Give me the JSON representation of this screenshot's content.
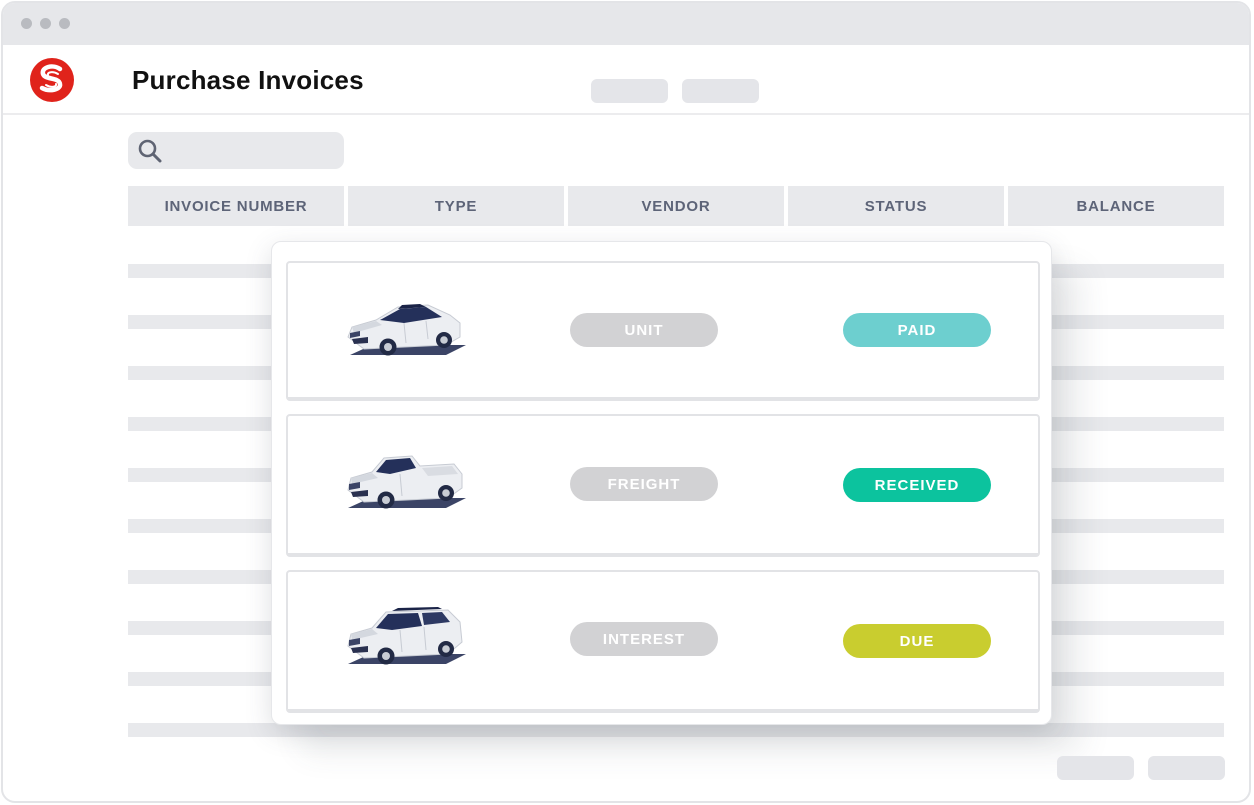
{
  "header": {
    "title": "Purchase Invoices"
  },
  "table": {
    "columns": [
      "INVOICE NUMBER",
      "TYPE",
      "VENDOR",
      "STATUS",
      "BALANCE"
    ]
  },
  "invoices": [
    {
      "vehicle_icon": "sedan-icon",
      "type": "UNIT",
      "status": "PAID",
      "status_color": "#6dcfcf"
    },
    {
      "vehicle_icon": "pickup-truck-icon",
      "type": "FREIGHT",
      "status": "RECEIVED",
      "status_color": "#0cc39e"
    },
    {
      "vehicle_icon": "suv-icon",
      "type": "INTEREST",
      "status": "DUE",
      "status_color": "#c9cd2f"
    }
  ],
  "colors": {
    "brand": "#e0231b",
    "type_pill": "#d2d2d4",
    "column_text": "#5d6478"
  }
}
